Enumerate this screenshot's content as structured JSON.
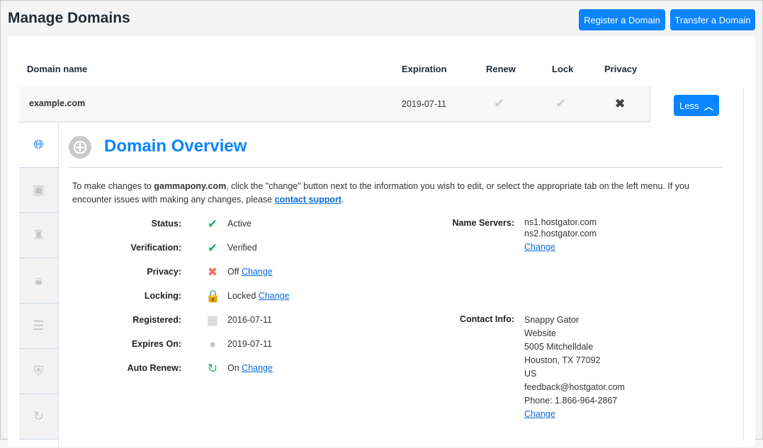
{
  "header": {
    "title": "Manage Domains",
    "register_label": "Register a Domain",
    "transfer_label": "Transfer a Domain"
  },
  "table": {
    "columns": [
      "Domain name",
      "Expiration",
      "Renew",
      "Lock",
      "Privacy"
    ],
    "row": {
      "domain": "example.com",
      "expiration": "2019-07-11",
      "renew": "check",
      "lock": "check",
      "privacy": "x",
      "less_label": "Less"
    }
  },
  "side_tabs": [
    "globe-icon",
    "contact-icon",
    "spy-icon",
    "lock-icon",
    "server-icon",
    "shield-icon",
    "refresh-icon"
  ],
  "overview": {
    "title": "Domain Overview",
    "intro_prefix": "To make changes to ",
    "intro_domain": "gammapony.com",
    "intro_mid": ", click the \"change\" button next to the information you wish to edit, or select the appropriate tab on the left menu. If you encounter issues with making any changes, please ",
    "intro_link": "contact support",
    "intro_end": ".",
    "details": [
      {
        "label": "Status:",
        "value": "Active",
        "icon": "✔",
        "color": "#1bb55c"
      },
      {
        "label": "Verification:",
        "value": "Verified",
        "icon": "✔",
        "color": "#1bb55c"
      },
      {
        "label": "Privacy:",
        "value": "Off",
        "icon": "✖",
        "color": "#f07060",
        "change": "Change"
      },
      {
        "label": "Locking:",
        "value": "Locked",
        "icon": "🔒",
        "color": "#1bb55c",
        "change": "Change"
      },
      {
        "label": "Registered:",
        "value": "2016-07-11",
        "icon": "▦",
        "color": "#c8c8c8"
      },
      {
        "label": "Expires On:",
        "value": "2019-07-11",
        "icon": "●",
        "color": "#c8c8c8"
      },
      {
        "label": "Auto Renew:",
        "value": "On",
        "icon": "↻",
        "color": "#1bb55c",
        "change": "Change"
      }
    ],
    "name_servers": {
      "label": "Name Servers:",
      "values": [
        "ns1.hostgator.com",
        "ns2.hostgator.com"
      ],
      "change": "Change"
    },
    "contact": {
      "label": "Contact Info:",
      "values": [
        "Snappy Gator",
        "Website",
        "5005 Mitchelldale",
        "Houston, TX 77092",
        "US",
        "feedback@hostgator.com",
        "Phone: 1.866-964-2867"
      ],
      "change": "Change"
    }
  }
}
